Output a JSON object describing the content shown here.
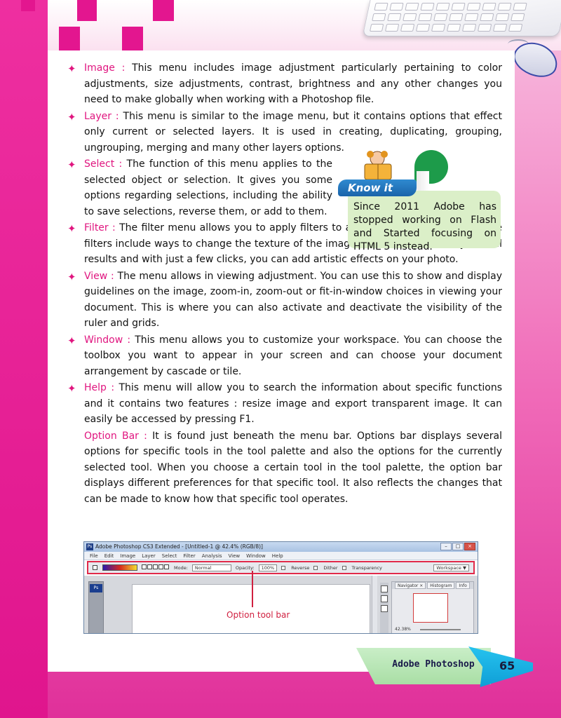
{
  "items": [
    {
      "term": "Image :",
      "text": " This menu includes image adjustment particularly pertaining to color adjustments, size adjustments, contrast, brightness and any other changes you need to make globally when working with a Photoshop file."
    },
    {
      "term": "Layer :",
      "text": " This menu is similar to the image menu, but it contains options that effect only current or selected layers. It is used in creating, duplicating, grouping, ungrouping, merging and many other layers options."
    },
    {
      "term": "Select :",
      "text": " The function of this menu applies to the selected object or selection. It gives you some options regarding selections, including the ability to save selections, reverse them, or add to them."
    },
    {
      "term": "Filter :",
      "text": " The filter menu allows you to apply filters to any part of your images. These filters include ways to change the texture of the image with some potentially radical results and with just a few clicks, you can add artistic effects on your photo."
    },
    {
      "term": "View :",
      "text": " The menu allows in viewing adjustment. You can use this to show and display guidelines on the image, zoom-in, zoom-out or fit-in-window choices in viewing your document. This is where you can also activate and deactivate the visibility of the ruler and grids."
    },
    {
      "term": "Window :",
      "text": " This menu allows you to customize your workspace. You can choose the toolbox you want to appear in your screen and can choose your document arrangement by cascade or tile."
    },
    {
      "term": "Help :",
      "text": " This menu will allow you to search the information about specific functions and it contains two features : resize image and export transparent image. It can easily be accessed by pressing F1."
    }
  ],
  "option_bar": {
    "term": "Option Bar :",
    "text": " It is found just beneath the menu bar. Options bar displays several options for specific tools in the tool palette and also the options for the currently selected tool. When you choose a certain tool in the tool palette, the option bar displays different preferences for that specific tool. It also reflects the changes that can be made to know how that specific tool operates."
  },
  "know_it": {
    "title": "Know it",
    "text": "Since 2011 Adobe has stopped working on Flash and Started focusing on HTML 5 instead."
  },
  "screenshot": {
    "title": "Adobe Photoshop CS3 Extended - [Untitled-1 @ 42.4% (RGB/8)]",
    "ps_logo": "Ps",
    "menus": [
      "File",
      "Edit",
      "Image",
      "Layer",
      "Select",
      "Filter",
      "Analysis",
      "View",
      "Window",
      "Help"
    ],
    "mode_label": "Mode:",
    "mode_value": "Normal",
    "opacity_label": "Opacity:",
    "opacity_value": "100%",
    "reverse_label": "Reverse",
    "dither_label": "Dither",
    "transparency_label": "Transparency",
    "workspace_label": "Workspace ▼",
    "panel_tabs": [
      "Navigator ×",
      "Histogram",
      "Info"
    ],
    "zoom_value": "42.38%",
    "callout": "Option tool bar"
  },
  "footer": {
    "book_title": "Adobe Photoshop",
    "page_number": "65"
  },
  "colors": {
    "accent_pink": "#e0157f",
    "know_green": "#dbefc8",
    "know_blue": "#1a64aa",
    "page_num_blue": "#0f9ed6"
  }
}
